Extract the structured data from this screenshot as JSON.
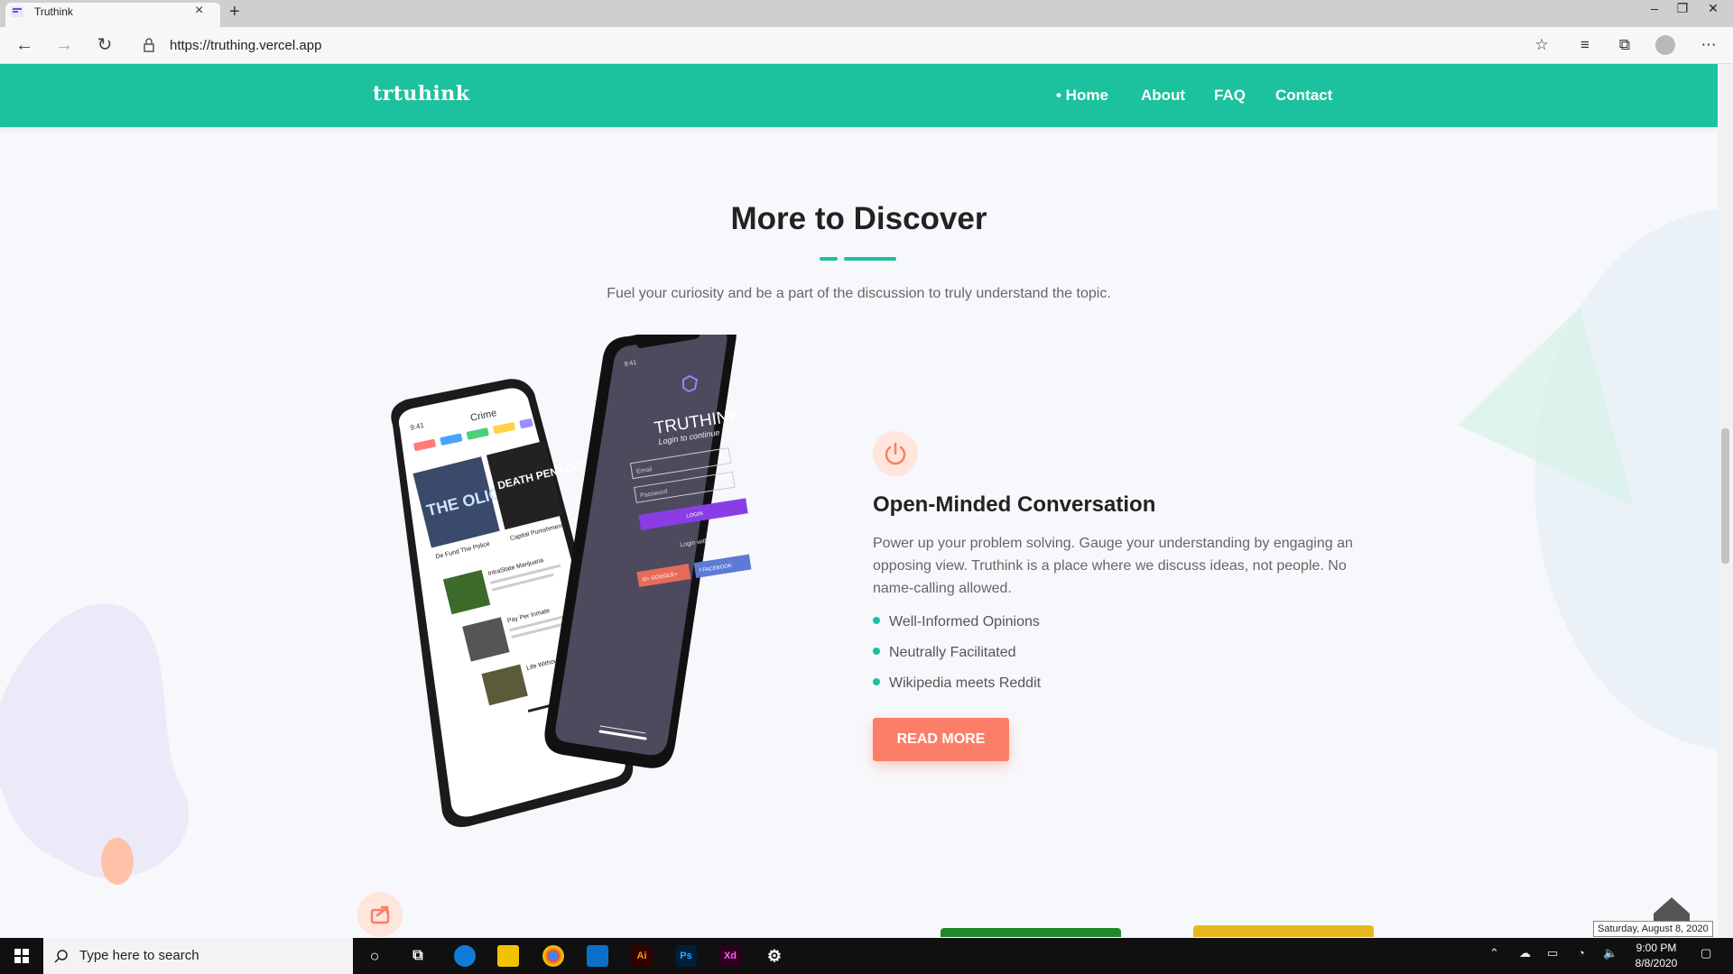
{
  "browser": {
    "tab_title": "Truthink",
    "url": "https://truthing.vercel.app"
  },
  "site": {
    "logo": "trtuhink",
    "nav": {
      "home": "• Home",
      "about": "About",
      "faq": "FAQ",
      "contact": "Contact"
    }
  },
  "section": {
    "title": "More to Discover",
    "subtitle": "Fuel your curiosity and be a part of the discussion to truly understand the topic."
  },
  "feature": {
    "title": "Open-Minded Conversation",
    "description": "Power up your problem solving. Gauge your understanding by engaging an opposing view. Truthink is a place where we discuss ideas, not people. No name-calling allowed.",
    "bullets": [
      "Well-Informed Opinions",
      "Neutrally Facilitated",
      "Wikipedia meets Reddit"
    ],
    "button": "READ MORE"
  },
  "phones": {
    "back": {
      "time": "9:41",
      "category": "Crime",
      "card1": "De Fund The Police",
      "card2": "Capital Punishment",
      "img1_text": "THE OLIC",
      "img2_text": "DEATH PENALTY",
      "item1": "IntraState Marijuana",
      "item2": "Pay Per Inmate",
      "item3": "Life Without Pa"
    },
    "front": {
      "time": "9:41",
      "brand": "TRUTHINK",
      "tagline": "Login to continue",
      "email": "Email",
      "password": "Password",
      "login": "LOGIN",
      "login_with": "Login with",
      "google": "G+ GOOGLE+",
      "facebook": "f FACEBOOK"
    }
  },
  "tooltip": "Saturday, August 8, 2020",
  "taskbar": {
    "search_placeholder": "Type here to search",
    "time": "9:00 PM",
    "date": "8/8/2020",
    "apps": [
      {
        "name": "Ai",
        "color": "#330000",
        "fg": "#ff9a00"
      },
      {
        "name": "Ps",
        "color": "#001e36",
        "fg": "#31a8ff"
      },
      {
        "name": "Xd",
        "color": "#2e001e",
        "fg": "#ff61f6"
      }
    ]
  },
  "colors": {
    "primary": "#1cc19e",
    "accent": "#fc7e68"
  }
}
